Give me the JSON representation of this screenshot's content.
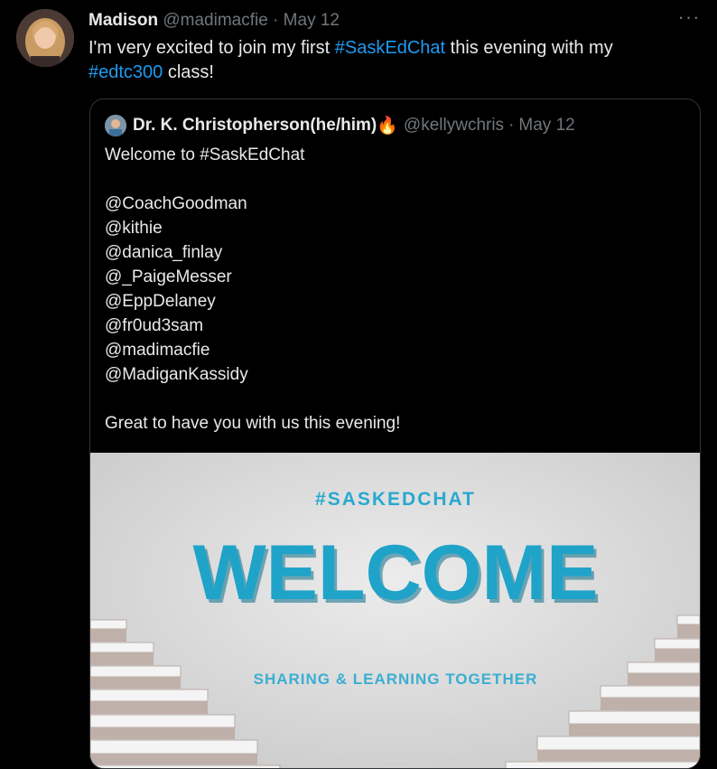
{
  "tweet": {
    "name": "Madison",
    "handle": "@madimacfie",
    "dot": "·",
    "date": "May 12",
    "more_label": "···",
    "text_before": "I'm very excited to join my first ",
    "hashtag1": "#SaskEdChat",
    "text_middle": " this evening with my",
    "hashtag2": "#edtc300",
    "text_after": " class!"
  },
  "quote": {
    "name": "Dr. K. Christopherson(he/him)",
    "emoji": "🔥",
    "handle": "@kellywchris",
    "dot": "·",
    "date": "May 12",
    "lines": [
      "Welcome to #SaskEdChat",
      "",
      "@CoachGoodman",
      "@kithie",
      "@danica_finlay",
      "@_PaigeMesser",
      "@EppDelaney",
      "@fr0ud3sam",
      "@madimacfie",
      "@MadiganKassidy",
      "",
      "Great to have you with us this evening!"
    ],
    "image": {
      "hashtag": "#SASKEDCHAT",
      "headline": "WELCOME",
      "tagline": "SHARING & LEARNING TOGETHER",
      "accent_color": "#1fa3c9",
      "background_color": "#e4e4e4"
    }
  }
}
